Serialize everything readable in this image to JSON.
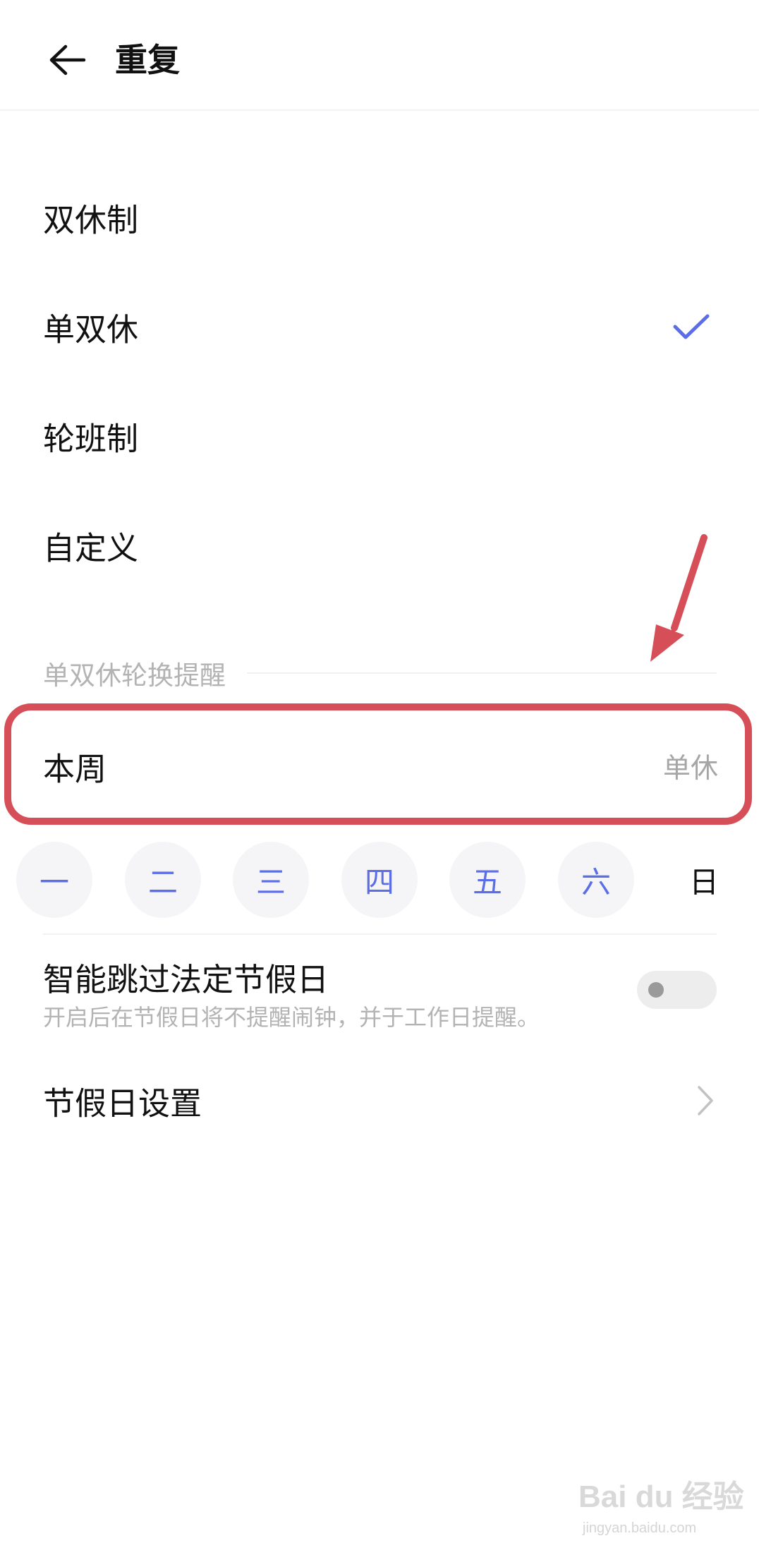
{
  "header": {
    "title": "重复",
    "back_icon": "arrow-left-icon"
  },
  "options": [
    {
      "label": "双休制",
      "selected": false
    },
    {
      "label": "单双休",
      "selected": true
    },
    {
      "label": "轮班制",
      "selected": false
    },
    {
      "label": "自定义",
      "selected": false
    }
  ],
  "accent_color": "#5b6ee8",
  "section": {
    "title": "单双休轮换提醒"
  },
  "this_week": {
    "label": "本周",
    "value": "单休"
  },
  "annotation_color": "#d64e57",
  "days": [
    {
      "label": "一",
      "selected": true
    },
    {
      "label": "二",
      "selected": true
    },
    {
      "label": "三",
      "selected": true
    },
    {
      "label": "四",
      "selected": true
    },
    {
      "label": "五",
      "selected": true
    },
    {
      "label": "六",
      "selected": true
    },
    {
      "label": "日",
      "selected": false
    }
  ],
  "skip_holidays": {
    "title": "智能跳过法定节假日",
    "description": "开启后在节假日将不提醒闹钟，并于工作日提醒。",
    "enabled": false
  },
  "holiday_settings": {
    "label": "节假日设置"
  },
  "watermark": {
    "logo": "Bai du 经验",
    "sub": "jingyan.baidu.com"
  }
}
